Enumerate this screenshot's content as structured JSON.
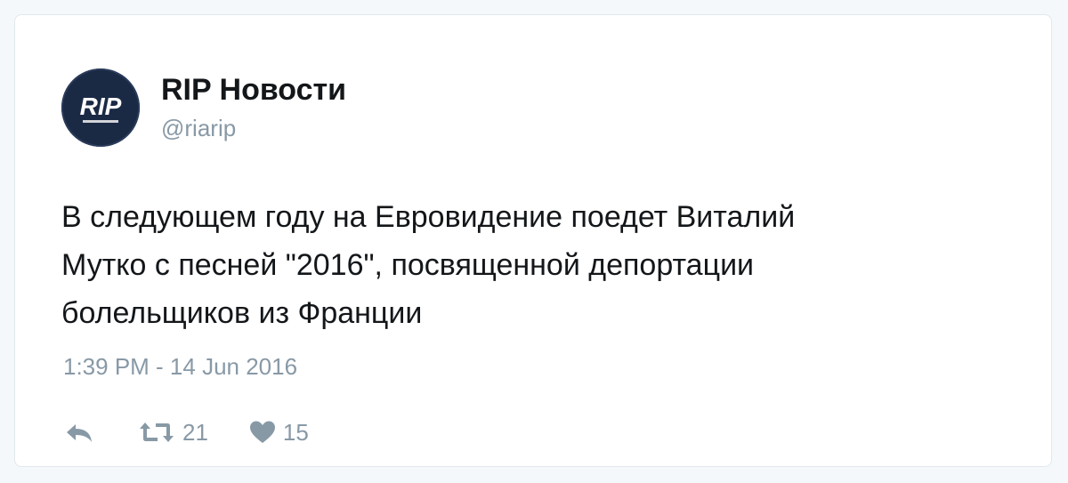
{
  "tweet": {
    "avatar_text": "RIP",
    "display_name": "RIP Новости",
    "handle": "@riarip",
    "text": "В следующем году на Евровидение поедет Виталий\nМутко с песней \"2016\", посвященной депортации\nболельщиков из Франции",
    "timestamp": "1:39 PM - 14 Jun 2016",
    "actions": {
      "reply_icon": "reply-icon",
      "retweet_icon": "retweet-icon",
      "retweet_count": "21",
      "like_icon": "heart-icon",
      "like_count": "15"
    }
  },
  "colors": {
    "text": "#14171a",
    "secondary": "#8899a6",
    "avatar_bg": "#1b2a44",
    "card_border": "#e1e8ed"
  }
}
